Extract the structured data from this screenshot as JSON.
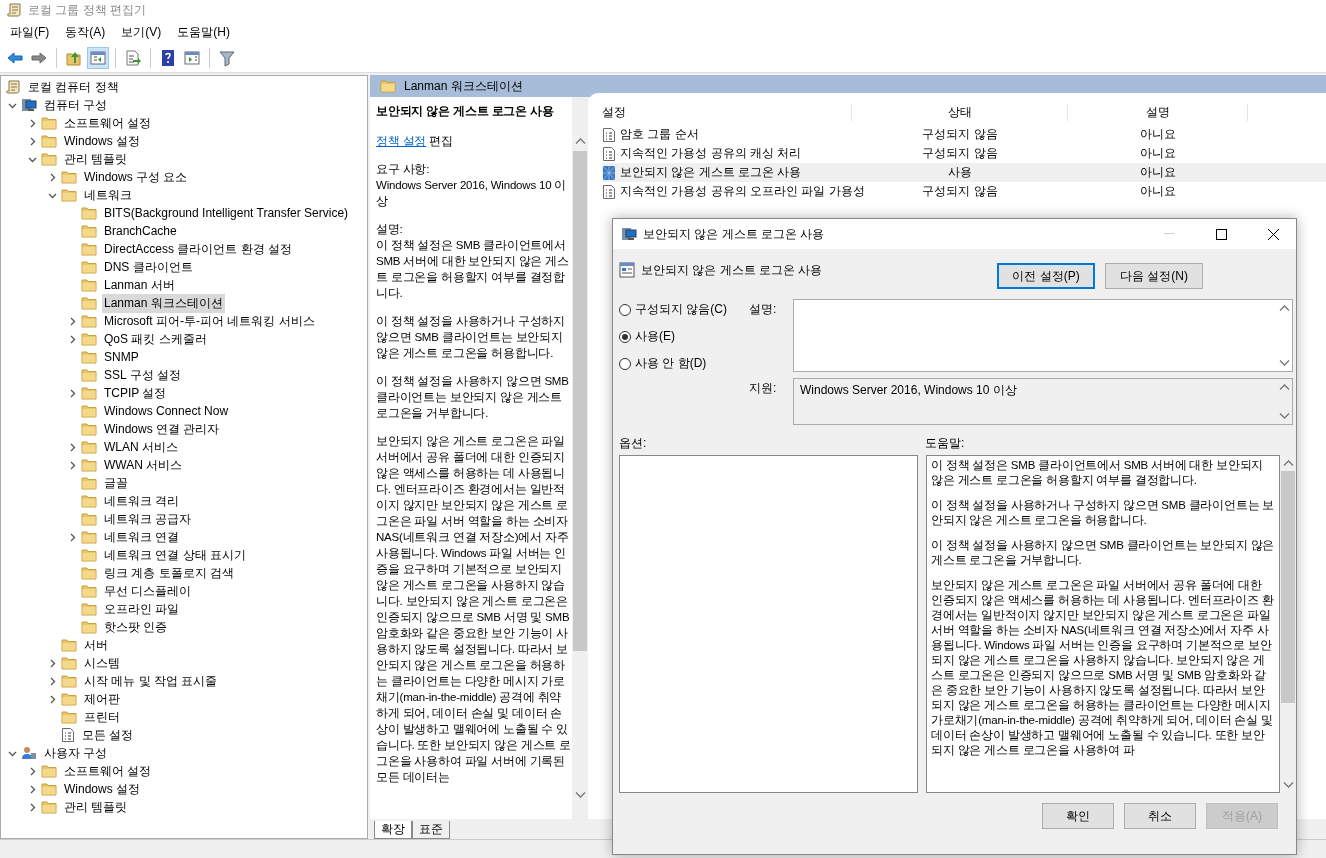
{
  "window": {
    "title": "로컬 그룹 정책 편집기"
  },
  "menu": [
    "파일(F)",
    "동작(A)",
    "보기(V)",
    "도움말(H)"
  ],
  "toolbar": [
    {
      "kind": "back",
      "pressed": false
    },
    {
      "kind": "forward",
      "pressed": false
    },
    {
      "kind": "up",
      "pressed": false
    },
    {
      "kind": "tree",
      "pressed": true
    },
    {
      "kind": "export",
      "pressed": false
    },
    {
      "kind": "help",
      "pressed": false
    },
    {
      "kind": "pane",
      "pressed": false
    },
    {
      "kind": "filter",
      "pressed": false
    }
  ],
  "tree": {
    "label": "로컬 컴퓨터 정책",
    "children": [
      {
        "label": "컴퓨터 구성",
        "kind": "computer",
        "expanded": true,
        "selected": false,
        "children": [
          {
            "label": "소프트웨어 설정",
            "kind": "folder",
            "expanded": false,
            "selected": false
          },
          {
            "label": "Windows 설정",
            "kind": "folder",
            "expanded": false,
            "selected": false
          },
          {
            "label": "관리 템플릿",
            "kind": "folder",
            "expanded": true,
            "selected": false,
            "children": [
              {
                "label": "Windows 구성 요소",
                "kind": "folder",
                "expanded": false,
                "selected": false
              },
              {
                "label": "네트워크",
                "kind": "folder",
                "expanded": true,
                "selected": false,
                "children": [
                  {
                    "label": "BITS(Background Intelligent Transfer Service)",
                    "kind": "folder",
                    "selected": false
                  },
                  {
                    "label": "BranchCache",
                    "kind": "folder",
                    "selected": false
                  },
                  {
                    "label": "DirectAccess 클라이언트 환경 설정",
                    "kind": "folder",
                    "selected": false
                  },
                  {
                    "label": "DNS 클라이언트",
                    "kind": "folder",
                    "selected": false
                  },
                  {
                    "label": "Lanman 서버",
                    "kind": "folder",
                    "selected": false
                  },
                  {
                    "label": "Lanman 워크스테이션",
                    "kind": "folder",
                    "selected": true
                  },
                  {
                    "label": "Microsoft 피어-투-피어 네트워킹 서비스",
                    "kind": "folder",
                    "expanded": false,
                    "selected": false
                  },
                  {
                    "label": "QoS 패킷 스케줄러",
                    "kind": "folder",
                    "expanded": false,
                    "selected": false
                  },
                  {
                    "label": "SNMP",
                    "kind": "folder",
                    "selected": false
                  },
                  {
                    "label": "SSL 구성 설정",
                    "kind": "folder",
                    "selected": false
                  },
                  {
                    "label": "TCPIP 설정",
                    "kind": "folder",
                    "expanded": false,
                    "selected": false
                  },
                  {
                    "label": "Windows Connect Now",
                    "kind": "folder",
                    "selected": false
                  },
                  {
                    "label": "Windows 연결 관리자",
                    "kind": "folder",
                    "selected": false
                  },
                  {
                    "label": "WLAN 서비스",
                    "kind": "folder",
                    "expanded": false,
                    "selected": false
                  },
                  {
                    "label": "WWAN 서비스",
                    "kind": "folder",
                    "expanded": false,
                    "selected": false
                  },
                  {
                    "label": "글꼴",
                    "kind": "folder",
                    "selected": false
                  },
                  {
                    "label": "네트워크 격리",
                    "kind": "folder",
                    "selected": false
                  },
                  {
                    "label": "네트워크 공급자",
                    "kind": "folder",
                    "selected": false
                  },
                  {
                    "label": "네트워크 연결",
                    "kind": "folder",
                    "expanded": false,
                    "selected": false
                  },
                  {
                    "label": "네트워크 연결 상태 표시기",
                    "kind": "folder",
                    "selected": false
                  },
                  {
                    "label": "링크 계층 토폴로지 검색",
                    "kind": "folder",
                    "selected": false
                  },
                  {
                    "label": "무선 디스플레이",
                    "kind": "folder",
                    "selected": false
                  },
                  {
                    "label": "오프라인 파일",
                    "kind": "folder",
                    "selected": false
                  },
                  {
                    "label": "핫스팟 인증",
                    "kind": "folder",
                    "selected": false
                  }
                ]
              },
              {
                "label": "서버",
                "kind": "folder",
                "selected": false
              },
              {
                "label": "시스템",
                "kind": "folder",
                "expanded": false,
                "selected": false
              },
              {
                "label": "시작 메뉴 및 작업 표시줄",
                "kind": "folder",
                "expanded": false,
                "selected": false
              },
              {
                "label": "제어판",
                "kind": "folder",
                "expanded": false,
                "selected": false
              },
              {
                "label": "프린터",
                "kind": "folder",
                "selected": false
              },
              {
                "label": "모든 설정",
                "kind": "settings",
                "selected": false
              }
            ]
          }
        ]
      },
      {
        "label": "사용자 구성",
        "kind": "user",
        "expanded": true,
        "selected": false,
        "children": [
          {
            "label": "소프트웨어 설정",
            "kind": "folder",
            "expanded": false,
            "selected": false
          },
          {
            "label": "Windows 설정",
            "kind": "folder",
            "expanded": false,
            "selected": false
          },
          {
            "label": "관리 템플릿",
            "kind": "folder",
            "expanded": false,
            "selected": false
          }
        ]
      }
    ]
  },
  "details": {
    "header": "Lanman 워크스테이션",
    "title": "보안되지 않은 게스트 로그온 사용",
    "link": "정책 설정",
    "link_suffix": "편집",
    "requirements_label": "요구 사항:",
    "requirements": "Windows Server 2016, Windows 10 이상",
    "description_label": "설명:",
    "paragraphs": [
      "이 정책 설정은 SMB 클라이언트에서 SMB 서버에 대한 보안되지 않은 게스트 로그온을 허용할지 여부를 결정합니다.",
      "이 정책 설정을 사용하거나 구성하지 않으면 SMB 클라이언트는 보안되지 않은 게스트 로그온을 허용합니다.",
      "이 정책 설정을 사용하지 않으면 SMB 클라이언트는 보안되지 않은 게스트 로그온을 거부합니다.",
      "보안되지 않은 게스트 로그온은 파일 서버에서 공유 폴더에 대한 인증되지 않은 액세스를 허용하는 데 사용됩니다. 엔터프라이즈 환경에서는 일반적이지 않지만 보안되지 않은 게스트 로그온은 파일 서버 역할을 하는 소비자 NAS(네트워크 연결 저장소)에서 자주 사용됩니다. Windows 파일 서버는 인증을 요구하며 기본적으로 보안되지 않은 게스트 로그온을 사용하지 않습니다. 보안되지 않은 게스트 로그온은 인증되지 않으므로 SMB 서명 및 SMB 암호화와 같은 중요한 보안 기능이 사용하지 않도록 설정됩니다. 따라서 보안되지 않은 게스트 로그온을 허용하는 클라이언트는 다양한 메시지 가로채기(man-in-the-middle) 공격에 취약하게 되어, 데이터 손실 및 데이터 손상이 발생하고 맬웨어에 노출될 수 있습니다. 또한 보안되지 않은 게스트 로그온을 사용하여 파일 서버에 기록된 모든 데이터는"
    ]
  },
  "view_tabs": [
    {
      "label": "확장",
      "selected": true
    },
    {
      "label": "표준",
      "selected": false
    }
  ],
  "list": {
    "columns": [
      "설정",
      "상태",
      "설명"
    ],
    "rows": [
      {
        "name": "암호 그룹 순서",
        "state": "구성되지 않음",
        "comment": "아니요",
        "selected": false
      },
      {
        "name": "지속적인 가용성 공유의 캐싱 처리",
        "state": "구성되지 않음",
        "comment": "아니요",
        "selected": false
      },
      {
        "name": "보안되지 않은 게스트 로그온 사용",
        "state": "사용",
        "comment": "아니요",
        "selected": true
      },
      {
        "name": "지속적인 가용성 공유의 오프라인 파일 가용성",
        "state": "구성되지 않음",
        "comment": "아니요",
        "selected": false
      }
    ]
  },
  "dialog": {
    "title": "보안되지 않은 게스트 로그온 사용",
    "policy_title": "보안되지 않은 게스트 로그온 사용",
    "nav_buttons": [
      {
        "label": "이전 설정(P)",
        "focused": true
      },
      {
        "label": "다음 설정(N)",
        "focused": false
      }
    ],
    "options": [
      {
        "label": "구성되지 않음(C)",
        "selected": false
      },
      {
        "label": "사용(E)",
        "selected": true
      },
      {
        "label": "사용 안 함(D)",
        "selected": false
      }
    ],
    "comment_label": "설명:",
    "support_label": "지원:",
    "support": "Windows Server 2016, Windows 10 이상",
    "options_label": "옵션:",
    "help_label": "도움말:",
    "help": [
      "이 정책 설정은 SMB 클라이언트에서 SMB 서버에 대한 보안되지 않은 게스트 로그온을 허용할지 여부를 결정합니다.",
      "이 정책 설정을 사용하거나 구성하지 않으면 SMB 클라이언트는 보안되지 않은 게스트 로그온을 허용합니다.",
      "이 정책 설정을 사용하지 않으면 SMB 클라이언트는 보안되지 않은 게스트 로그온을 거부합니다.",
      "보안되지 않은 게스트 로그온은 파일 서버에서 공유 폴더에 대한 인증되지 않은 액세스를 허용하는 데 사용됩니다. 엔터프라이즈 환경에서는 일반적이지 않지만 보안되지 않은 게스트 로그온은 파일 서버 역할을 하는 소비자 NAS(네트워크 연결 저장소)에서 자주 사용됩니다. Windows 파일 서버는 인증을 요구하며 기본적으로 보안되지 않은 게스트 로그온을 사용하지 않습니다. 보안되지 않은 게스트 로그온은 인증되지 않으므로 SMB 서명 및 SMB 암호화와 같은 중요한 보안 기능이 사용하지 않도록 설정됩니다. 따라서 보안되지 않은 게스트 로그온을 허용하는 클라이언트는 다양한 메시지 가로채기(man-in-the-middle) 공격에 취약하게 되어, 데이터 손실 및 데이터 손상이 발생하고 맬웨어에 노출될 수 있습니다. 또한 보안되지 않은 게스트 로그온을 사용하여 파"
    ],
    "buttons": [
      {
        "label": "확인",
        "disabled": false
      },
      {
        "label": "취소",
        "disabled": false
      },
      {
        "label": "적용(A)",
        "disabled": true
      }
    ]
  }
}
